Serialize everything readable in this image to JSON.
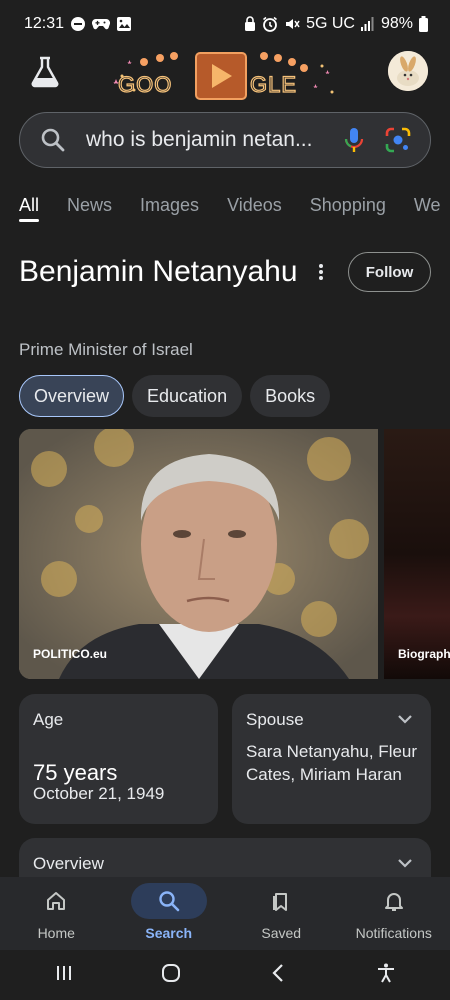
{
  "status_bar": {
    "time": "12:31",
    "network": "5G UC",
    "battery": "98%"
  },
  "header": {
    "doodle_text": "GOOGLE"
  },
  "search": {
    "query": "who is benjamin netan..."
  },
  "tabs": [
    {
      "label": "All",
      "active": true
    },
    {
      "label": "News"
    },
    {
      "label": "Images"
    },
    {
      "label": "Videos"
    },
    {
      "label": "Shopping"
    },
    {
      "label": "We"
    }
  ],
  "entity": {
    "title": "Benjamin Netanyahu",
    "subtitle": "Prime Minister of Israel",
    "follow_label": "Follow"
  },
  "chips": [
    {
      "label": "Overview",
      "selected": true
    },
    {
      "label": "Education"
    },
    {
      "label": "Books"
    }
  ],
  "images": [
    {
      "caption": "POLITICO.eu"
    },
    {
      "caption": "Biography"
    }
  ],
  "cards": {
    "age": {
      "label": "Age",
      "value": "75 years",
      "date": "October 21, 1949"
    },
    "spouse": {
      "label": "Spouse",
      "value": "Sara Netanyahu, Fleur Cates, Miriam Haran"
    },
    "overview": {
      "label": "Overview"
    }
  },
  "bottom_nav": [
    {
      "label": "Home",
      "icon": "home-icon"
    },
    {
      "label": "Search",
      "icon": "search-icon",
      "active": true
    },
    {
      "label": "Saved",
      "icon": "saved-icon"
    },
    {
      "label": "Notifications",
      "icon": "bell-icon"
    }
  ],
  "colors": {
    "background": "#1f1f1f",
    "surface": "#303134",
    "accent_blue": "#8ab4f8"
  }
}
